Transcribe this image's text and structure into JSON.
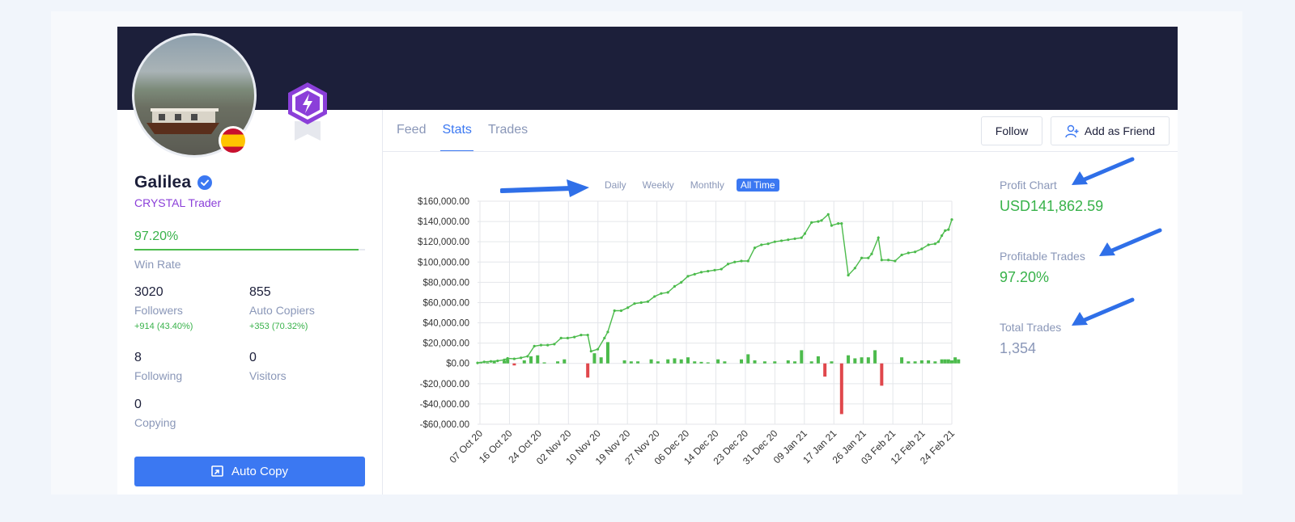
{
  "profile": {
    "name": "Galilea",
    "level": "CRYSTAL Trader",
    "win_rate_value": "97.20%",
    "win_rate_fraction": 0.972,
    "win_rate_label": "Win Rate",
    "followers": {
      "value": "3020",
      "label": "Followers",
      "delta": "+914 (43.40%)"
    },
    "auto_copiers": {
      "value": "855",
      "label": "Auto Copiers",
      "delta": "+353 (70.32%)"
    },
    "following": {
      "value": "8",
      "label": "Following"
    },
    "visitors": {
      "value": "0",
      "label": "Visitors"
    },
    "copying": {
      "value": "0",
      "label": "Copying"
    },
    "auto_copy_label": "Auto Copy"
  },
  "tabs": [
    {
      "label": "Feed",
      "active": false
    },
    {
      "label": "Stats",
      "active": true
    },
    {
      "label": "Trades",
      "active": false
    }
  ],
  "actions": {
    "follow_label": "Follow",
    "add_friend_label": "Add as Friend"
  },
  "periods": [
    {
      "label": "Daily",
      "active": false
    },
    {
      "label": "Weekly",
      "active": false
    },
    {
      "label": "Monthly",
      "active": false
    },
    {
      "label": "All Time",
      "active": true
    }
  ],
  "metrics": {
    "profit_chart": {
      "title": "Profit Chart",
      "value": "USD141,862.59"
    },
    "profitable_trades": {
      "title": "Profitable Trades",
      "value": "97.20%"
    },
    "total_trades": {
      "title": "Total Trades",
      "value": "1,354"
    }
  },
  "colors": {
    "accent": "#3b78f2",
    "banner": "#1c1f3a",
    "profit": "#4cbb4c",
    "loss": "#e0474c",
    "level": "#8b3fd9"
  },
  "chart_data": {
    "type": "line",
    "title": "",
    "xlabel": "",
    "ylabel": "",
    "ylim": [
      -60000,
      160000
    ],
    "y_ticks": [
      "$160,000.00",
      "$140,000.00",
      "$120,000.00",
      "$100,000.00",
      "$80,000.00",
      "$60,000.00",
      "$40,000.00",
      "$20,000.00",
      "$0.00",
      "-$20,000.00",
      "-$40,000.00",
      "-$60,000.00"
    ],
    "x_ticks": [
      "07 Oct 20",
      "16 Oct 20",
      "24 Oct 20",
      "02 Nov 20",
      "10 Nov 20",
      "19 Nov 20",
      "27 Nov 20",
      "06 Dec 20",
      "14 Dec 20",
      "23 Dec 20",
      "31 Dec 20",
      "09 Jan 21",
      "17 Jan 21",
      "26 Jan 21",
      "03 Feb 21",
      "12 Feb 21",
      "24 Feb 21"
    ],
    "x_range": [
      "2020-10-07",
      "2021-02-24"
    ],
    "grid": true,
    "legend": "none",
    "series": [
      {
        "kind": "line",
        "color": "#4cbb4c",
        "points": [
          [
            "2020-10-07",
            500
          ],
          [
            "2020-10-09",
            1500
          ],
          [
            "2020-10-11",
            2000
          ],
          [
            "2020-10-13",
            2500
          ],
          [
            "2020-10-15",
            3500
          ],
          [
            "2020-10-16",
            5000
          ],
          [
            "2020-10-18",
            4500
          ],
          [
            "2020-10-20",
            5500
          ],
          [
            "2020-10-22",
            7000
          ],
          [
            "2020-10-24",
            17000
          ],
          [
            "2020-10-26",
            18000
          ],
          [
            "2020-10-28",
            18000
          ],
          [
            "2020-10-30",
            19000
          ],
          [
            "2020-11-01",
            25000
          ],
          [
            "2020-11-03",
            25000
          ],
          [
            "2020-11-05",
            26000
          ],
          [
            "2020-11-07",
            28000
          ],
          [
            "2020-11-09",
            28000
          ],
          [
            "2020-11-10",
            12000
          ],
          [
            "2020-11-12",
            14000
          ],
          [
            "2020-11-14",
            25000
          ],
          [
            "2020-11-15",
            31000
          ],
          [
            "2020-11-17",
            52000
          ],
          [
            "2020-11-19",
            52000
          ],
          [
            "2020-11-21",
            55000
          ],
          [
            "2020-11-23",
            59000
          ],
          [
            "2020-11-25",
            60000
          ],
          [
            "2020-11-27",
            61000
          ],
          [
            "2020-11-29",
            66000
          ],
          [
            "2020-12-01",
            69000
          ],
          [
            "2020-12-03",
            70000
          ],
          [
            "2020-12-05",
            76000
          ],
          [
            "2020-12-07",
            80000
          ],
          [
            "2020-12-09",
            86000
          ],
          [
            "2020-12-11",
            88000
          ],
          [
            "2020-12-13",
            90000
          ],
          [
            "2020-12-15",
            91000
          ],
          [
            "2020-12-17",
            92000
          ],
          [
            "2020-12-19",
            93000
          ],
          [
            "2020-12-21",
            98000
          ],
          [
            "2020-12-23",
            100000
          ],
          [
            "2020-12-25",
            101000
          ],
          [
            "2020-12-27",
            101000
          ],
          [
            "2020-12-29",
            114000
          ],
          [
            "2020-12-31",
            117000
          ],
          [
            "2021-01-02",
            118000
          ],
          [
            "2021-01-04",
            120000
          ],
          [
            "2021-01-06",
            121000
          ],
          [
            "2021-01-08",
            122000
          ],
          [
            "2021-01-10",
            123000
          ],
          [
            "2021-01-12",
            124000
          ],
          [
            "2021-01-13",
            128000
          ],
          [
            "2021-01-15",
            139000
          ],
          [
            "2021-01-17",
            140000
          ],
          [
            "2021-01-18",
            141000
          ],
          [
            "2021-01-20",
            147000
          ],
          [
            "2021-01-21",
            136000
          ],
          [
            "2021-01-23",
            138000
          ],
          [
            "2021-01-24",
            138000
          ],
          [
            "2021-01-26",
            87000
          ],
          [
            "2021-01-28",
            94000
          ],
          [
            "2021-01-30",
            104000
          ],
          [
            "2021-02-01",
            104000
          ],
          [
            "2021-02-02",
            108000
          ],
          [
            "2021-02-04",
            124000
          ],
          [
            "2021-02-05",
            102000
          ],
          [
            "2021-02-07",
            102000
          ],
          [
            "2021-02-09",
            101000
          ],
          [
            "2021-02-11",
            107000
          ],
          [
            "2021-02-13",
            109000
          ],
          [
            "2021-02-15",
            110000
          ],
          [
            "2021-02-17",
            113000
          ],
          [
            "2021-02-19",
            117000
          ],
          [
            "2021-02-21",
            118000
          ],
          [
            "2021-02-22",
            120000
          ],
          [
            "2021-02-23",
            126000
          ],
          [
            "2021-02-24",
            131000
          ],
          [
            "2021-02-25",
            132000
          ],
          [
            "2021-02-26",
            141862
          ]
        ]
      },
      {
        "kind": "bar",
        "points": [
          [
            "2020-10-08",
            1500
          ],
          [
            "2020-10-10",
            1000
          ],
          [
            "2020-10-12",
            2000
          ],
          [
            "2020-10-15",
            2500
          ],
          [
            "2020-10-16",
            4000
          ],
          [
            "2020-10-18",
            -2000
          ],
          [
            "2020-10-21",
            3000
          ],
          [
            "2020-10-23",
            7000
          ],
          [
            "2020-10-25",
            8000
          ],
          [
            "2020-10-27",
            1000
          ],
          [
            "2020-10-31",
            2000
          ],
          [
            "2020-11-02",
            4000
          ],
          [
            "2020-11-09",
            -14000
          ],
          [
            "2020-11-11",
            10000
          ],
          [
            "2020-11-13",
            6000
          ],
          [
            "2020-11-15",
            21000
          ],
          [
            "2020-11-20",
            3000
          ],
          [
            "2020-11-22",
            2000
          ],
          [
            "2020-11-24",
            2000
          ],
          [
            "2020-11-28",
            4000
          ],
          [
            "2020-11-30",
            2000
          ],
          [
            "2020-12-03",
            4000
          ],
          [
            "2020-12-05",
            5000
          ],
          [
            "2020-12-07",
            4000
          ],
          [
            "2020-12-09",
            6000
          ],
          [
            "2020-12-11",
            2000
          ],
          [
            "2020-12-13",
            1500
          ],
          [
            "2020-12-15",
            1000
          ],
          [
            "2020-12-18",
            4000
          ],
          [
            "2020-12-20",
            2000
          ],
          [
            "2020-12-25",
            4000
          ],
          [
            "2020-12-27",
            9000
          ],
          [
            "2020-12-29",
            3000
          ],
          [
            "2021-01-01",
            2000
          ],
          [
            "2021-01-04",
            2000
          ],
          [
            "2021-01-08",
            3000
          ],
          [
            "2021-01-10",
            2000
          ],
          [
            "2021-01-12",
            13000
          ],
          [
            "2021-01-15",
            2000
          ],
          [
            "2021-01-17",
            7000
          ],
          [
            "2021-01-19",
            -13000
          ],
          [
            "2021-01-21",
            2000
          ],
          [
            "2021-01-24",
            -50000
          ],
          [
            "2021-01-26",
            8000
          ],
          [
            "2021-01-28",
            5000
          ],
          [
            "2021-01-30",
            6000
          ],
          [
            "2021-02-01",
            6000
          ],
          [
            "2021-02-03",
            13000
          ],
          [
            "2021-02-05",
            -22000
          ],
          [
            "2021-02-11",
            6000
          ],
          [
            "2021-02-13",
            2000
          ],
          [
            "2021-02-15",
            2000
          ],
          [
            "2021-02-17",
            3000
          ],
          [
            "2021-02-19",
            3000
          ],
          [
            "2021-02-21",
            2000
          ],
          [
            "2021-02-23",
            4000
          ],
          [
            "2021-02-24",
            4000
          ],
          [
            "2021-02-25",
            4000
          ],
          [
            "2021-02-26",
            3000
          ],
          [
            "2021-02-27",
            6000
          ],
          [
            "2021-02-28",
            4000
          ]
        ]
      }
    ]
  }
}
